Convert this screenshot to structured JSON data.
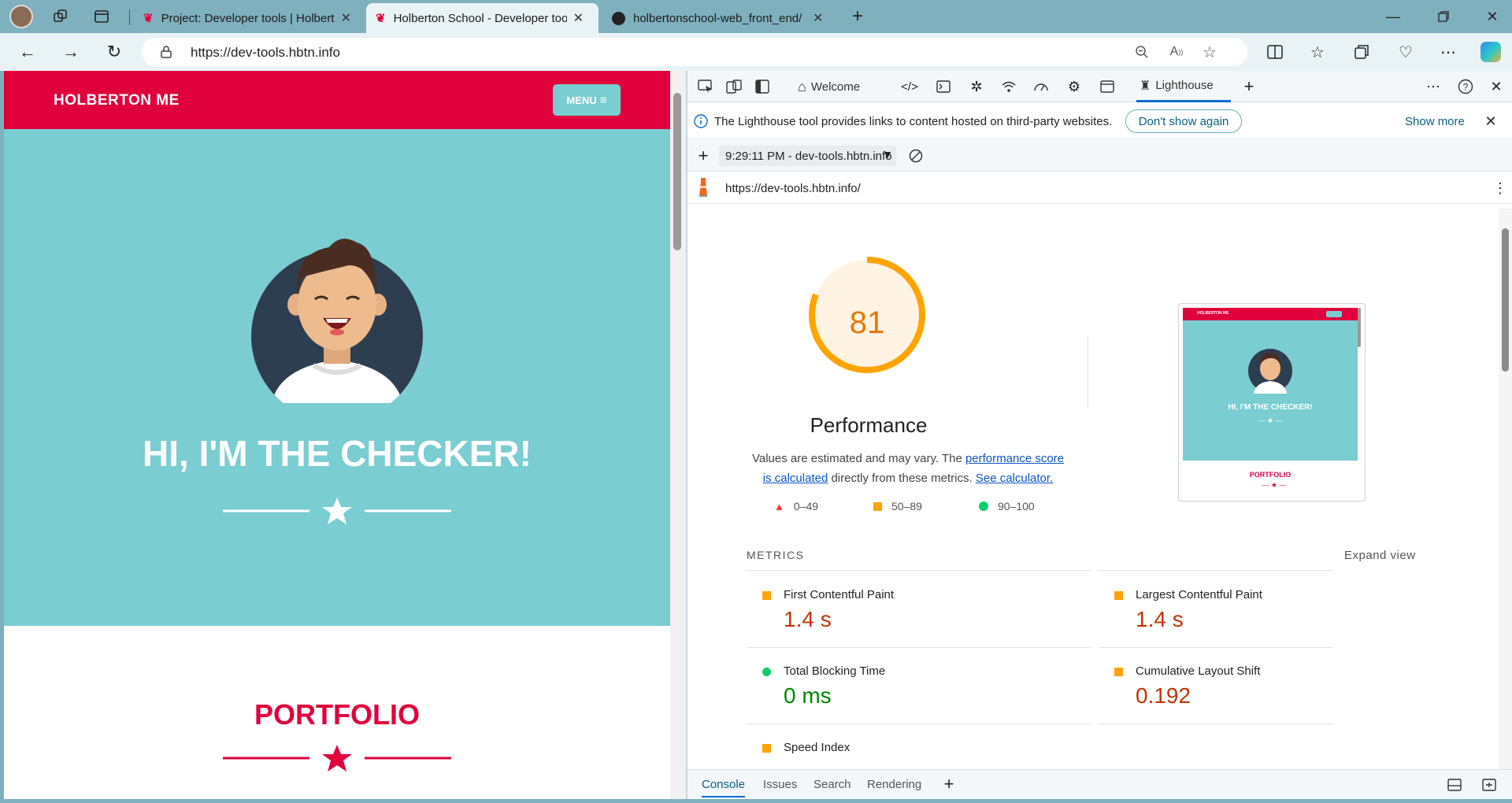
{
  "browser": {
    "tabs": [
      {
        "title": "Project: Developer tools | Holberton"
      },
      {
        "title": "Holberton School - Developer tools"
      },
      {
        "title": "holbertonschool-web_front_end/"
      }
    ],
    "url": "https://dev-tools.hbtn.info"
  },
  "page": {
    "brand": "HOLBERTON ME",
    "menu_label": "MENU",
    "hero_title": "HI, I'M THE CHECKER!",
    "portfolio_title": "PORTFOLIO",
    "colors": {
      "red": "#e0003c",
      "teal": "#7acdd1"
    }
  },
  "devtools": {
    "tabs": {
      "welcome": "Welcome",
      "lighthouse": "Lighthouse"
    },
    "info_text": "The Lighthouse tool provides links to content hosted on third-party websites.",
    "dont_show": "Don't show again",
    "show_more": "Show more",
    "report_select": "9:29:11 PM - dev-tools.hbtn.info",
    "report_url": "https://dev-tools.hbtn.info/",
    "score": "81",
    "score_fraction": 0.81,
    "category": "Performance",
    "desc_prefix": "Values are estimated and may vary. The ",
    "desc_link1": "performance score is calculated",
    "desc_mid": " directly from these metrics. ",
    "desc_link2": "See calculator.",
    "legend": {
      "fail": "0–49",
      "average": "50–89",
      "pass": "90–100"
    },
    "metrics_heading": "METRICS",
    "expand_view": "Expand view",
    "metrics": [
      {
        "name": "First Contentful Paint",
        "value": "1.4 s",
        "rating": "average"
      },
      {
        "name": "Largest Contentful Paint",
        "value": "1.4 s",
        "rating": "average"
      },
      {
        "name": "Total Blocking Time",
        "value": "0 ms",
        "rating": "pass"
      },
      {
        "name": "Cumulative Layout Shift",
        "value": "0.192",
        "rating": "average"
      },
      {
        "name": "Speed Index",
        "value": "",
        "rating": "average"
      }
    ],
    "thumbnail": {
      "brand": "HOLBERTON ME",
      "hero": "HI, I'M THE CHECKER!",
      "portfolio": "PORTFOLIO"
    },
    "drawer_tabs": {
      "console": "Console",
      "issues": "Issues",
      "search": "Search",
      "rendering": "Rendering"
    }
  }
}
